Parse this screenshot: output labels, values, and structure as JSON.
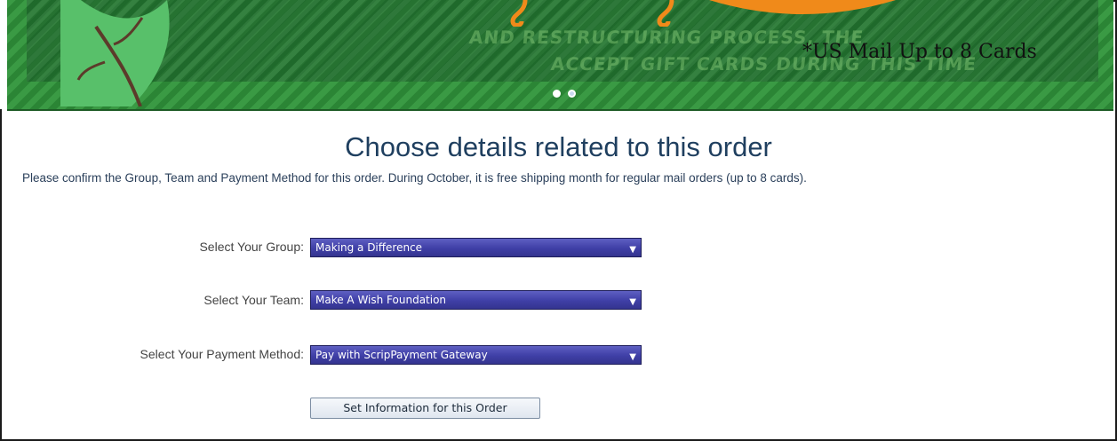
{
  "banner": {
    "mail_text": "*US Mail Up to 8 Cards",
    "faded_lines": [
      "AND RESTRUCTURING PROCESS, THE",
      "ACCEPT GIFT CARDS DURING THIS TIME"
    ],
    "carousel_dots": [
      "active",
      "inactive"
    ]
  },
  "page": {
    "title": "Choose details related to this order",
    "intro": "Please confirm the Group, Team and Payment Method for this order. During October, it is free shipping month for regular mail orders (up to 8 cards)."
  },
  "form": {
    "group_label": "Select Your Group:",
    "group_value": "Making a Difference",
    "team_label": "Select Your Team:",
    "team_value": "Make A Wish Foundation",
    "payment_label": "Select Your Payment Method:",
    "payment_value": "Pay with ScripPayment Gateway",
    "submit_label": "Set Information for this Order"
  },
  "colors": {
    "banner_green": "#2f8f3a",
    "select_blue": "#3f3fa6",
    "heading": "#1f3f5f"
  },
  "icons": {
    "dropdown": "chevron-down-icon"
  }
}
